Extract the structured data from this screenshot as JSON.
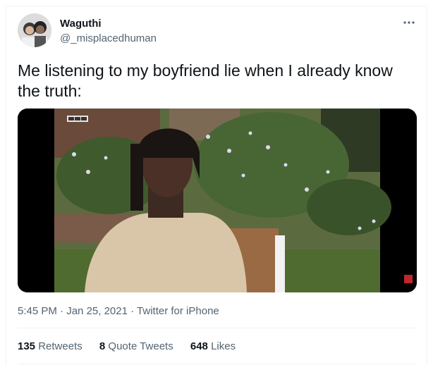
{
  "author": {
    "name": "Waguthi",
    "handle": "@_misplacedhuman"
  },
  "tweet": {
    "text": "Me listening to my boyfriend lie when I already know the truth:"
  },
  "media": {
    "badge": "BBC"
  },
  "meta": {
    "time": "5:45 PM",
    "date": "Jan 25, 2021",
    "source": "Twitter for iPhone",
    "sep": "·"
  },
  "stats": {
    "retweets": {
      "count": "135",
      "label": "Retweets"
    },
    "quotes": {
      "count": "8",
      "label": "Quote Tweets"
    },
    "likes": {
      "count": "648",
      "label": "Likes"
    }
  },
  "icons": {
    "more": "more-horizontal-icon",
    "avatar": "profile-photo"
  },
  "colors": {
    "text": "#0f1419",
    "secondary": "#536471",
    "border": "#eff3f4"
  }
}
